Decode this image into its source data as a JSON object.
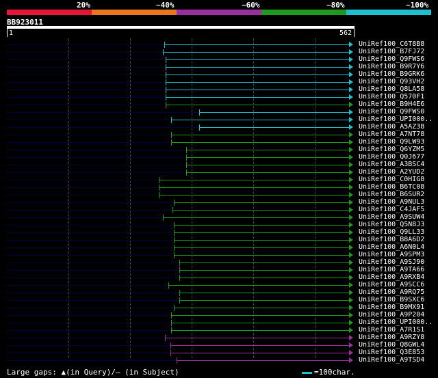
{
  "legend": {
    "labels": [
      "20%",
      "~40%",
      "~60%",
      "~80%",
      "~100%"
    ],
    "colors": [
      "#e5163a",
      "#e8771f",
      "#9a2fa0",
      "#1e9a1e",
      "#1fbfcf"
    ]
  },
  "query": {
    "name": "BB923011",
    "start_label": "1",
    "end_label": "562"
  },
  "hits": [
    {
      "label": "UniRef100_C6T8B8",
      "start": 1,
      "end": 562,
      "color_idx": 4,
      "gaps": []
    },
    {
      "label": "UniRef100_B7FJ72",
      "start": 1,
      "end": 562,
      "color_idx": 4,
      "gaps": []
    },
    {
      "label": "UniRef100_Q9FWS6",
      "start": 1,
      "end": 562,
      "color_idx": 4,
      "gaps": []
    },
    {
      "label": "UniRef100_B9R7Y6",
      "start": 1,
      "end": 562,
      "color_idx": 4,
      "gaps": []
    },
    {
      "label": "UniRef100_B9GRK6",
      "start": 1,
      "end": 562,
      "color_idx": 4,
      "gaps": []
    },
    {
      "label": "UniRef100_Q93VH2",
      "start": 1,
      "end": 562,
      "color_idx": 4,
      "gaps": []
    },
    {
      "label": "UniRef100_Q8LA58",
      "start": 1,
      "end": 562,
      "color_idx": 4,
      "gaps": []
    },
    {
      "label": "UniRef100_Q570F1",
      "start": 1,
      "end": 562,
      "color_idx": 4,
      "gaps": []
    },
    {
      "label": "UniRef100_B9H4E6",
      "start": 1,
      "end": 562,
      "color_idx": 3,
      "gaps": []
    },
    {
      "label": "UniRef100_Q9FWS0",
      "start": 1,
      "end": 562,
      "color_idx": 4,
      "gaps": []
    },
    {
      "label": "UniRef100_UPI000..",
      "start": 1,
      "end": 562,
      "color_idx": 4,
      "gaps": []
    },
    {
      "label": "UniRef100_A5AZ38",
      "start": 1,
      "end": 562,
      "color_idx": 4,
      "gaps": []
    },
    {
      "label": "UniRef100_A7NT78",
      "start": 1,
      "end": 562,
      "color_idx": 3,
      "gaps": []
    },
    {
      "label": "UniRef100_Q9LW93",
      "start": 1,
      "end": 562,
      "color_idx": 3,
      "gaps": []
    },
    {
      "label": "UniRef100_Q6YZM5",
      "start": 1,
      "end": 562,
      "color_idx": 3,
      "gaps": []
    },
    {
      "label": "UniRef100_Q0J677",
      "start": 1,
      "end": 562,
      "color_idx": 3,
      "gaps": []
    },
    {
      "label": "UniRef100_A3BSC4",
      "start": 1,
      "end": 562,
      "color_idx": 3,
      "gaps": []
    },
    {
      "label": "UniRef100_A2YUD2",
      "start": 1,
      "end": 562,
      "color_idx": 3,
      "gaps": []
    },
    {
      "label": "UniRef100_C0HIG8",
      "start": 1,
      "end": 562,
      "color_idx": 3,
      "gaps": []
    },
    {
      "label": "UniRef100_B6TC08",
      "start": 1,
      "end": 562,
      "color_idx": 3,
      "gaps": []
    },
    {
      "label": "UniRef100_B6SUR2",
      "start": 1,
      "end": 562,
      "color_idx": 3,
      "gaps": []
    },
    {
      "label": "UniRef100_A9NUL3",
      "start": 1,
      "end": 562,
      "color_idx": 3,
      "gaps": []
    },
    {
      "label": "UniRef100_C4JAF5",
      "start": 1,
      "end": 562,
      "color_idx": 3,
      "gaps": []
    },
    {
      "label": "UniRef100_A9SUW4",
      "start": 1,
      "end": 562,
      "color_idx": 3,
      "gaps": []
    },
    {
      "label": "UniRef100_Q5N8J3",
      "start": 1,
      "end": 562,
      "color_idx": 3,
      "gaps": []
    },
    {
      "label": "UniRef100_Q9LL33",
      "start": 1,
      "end": 562,
      "color_idx": 3,
      "gaps": []
    },
    {
      "label": "UniRef100_B8A6D2",
      "start": 1,
      "end": 562,
      "color_idx": 3,
      "gaps": []
    },
    {
      "label": "UniRef100_A6N0L4",
      "start": 1,
      "end": 562,
      "color_idx": 3,
      "gaps": []
    },
    {
      "label": "UniRef100_A9SPM3",
      "start": 1,
      "end": 562,
      "color_idx": 3,
      "gaps": []
    },
    {
      "label": "UniRef100_A9SJ90",
      "start": 1,
      "end": 562,
      "color_idx": 3,
      "gaps": []
    },
    {
      "label": "UniRef100_A9TA66",
      "start": 1,
      "end": 562,
      "color_idx": 3,
      "gaps": []
    },
    {
      "label": "UniRef100_A9RXB4",
      "start": 1,
      "end": 562,
      "color_idx": 3,
      "gaps": []
    },
    {
      "label": "UniRef100_A9SCC6",
      "start": 1,
      "end": 562,
      "color_idx": 3,
      "gaps": []
    },
    {
      "label": "UniRef100_A9RQ75",
      "start": 1,
      "end": 562,
      "color_idx": 3,
      "gaps": []
    },
    {
      "label": "UniRef100_B9SXC6",
      "start": 1,
      "end": 562,
      "color_idx": 3,
      "gaps": []
    },
    {
      "label": "UniRef100_B9MX91",
      "start": 1,
      "end": 562,
      "color_idx": 3,
      "gaps": []
    },
    {
      "label": "UniRef100_A9P204",
      "start": 1,
      "end": 562,
      "color_idx": 3,
      "gaps": []
    },
    {
      "label": "UniRef100_UPI000..",
      "start": 1,
      "end": 562,
      "color_idx": 3,
      "gaps": []
    },
    {
      "label": "UniRef100_A7R1S1",
      "start": 1,
      "end": 562,
      "color_idx": 3,
      "gaps": []
    },
    {
      "label": "UniRef100_A9RZY8",
      "start": 1,
      "end": 562,
      "color_idx": 2,
      "gaps": []
    },
    {
      "label": "UniRef100_Q8GWL4",
      "start": 1,
      "end": 562,
      "color_idx": 2,
      "gaps": []
    },
    {
      "label": "UniRef100_Q3E853",
      "start": 1,
      "end": 562,
      "color_idx": 2,
      "gaps": []
    },
    {
      "label": "UniRef100_A9TSD4",
      "start": 1,
      "end": 562,
      "color_idx": 2,
      "gaps": []
    }
  ],
  "footer": {
    "text": "Large gaps: ▲(in Query)/– (in Subject)",
    "scale_label": "=100char."
  }
}
